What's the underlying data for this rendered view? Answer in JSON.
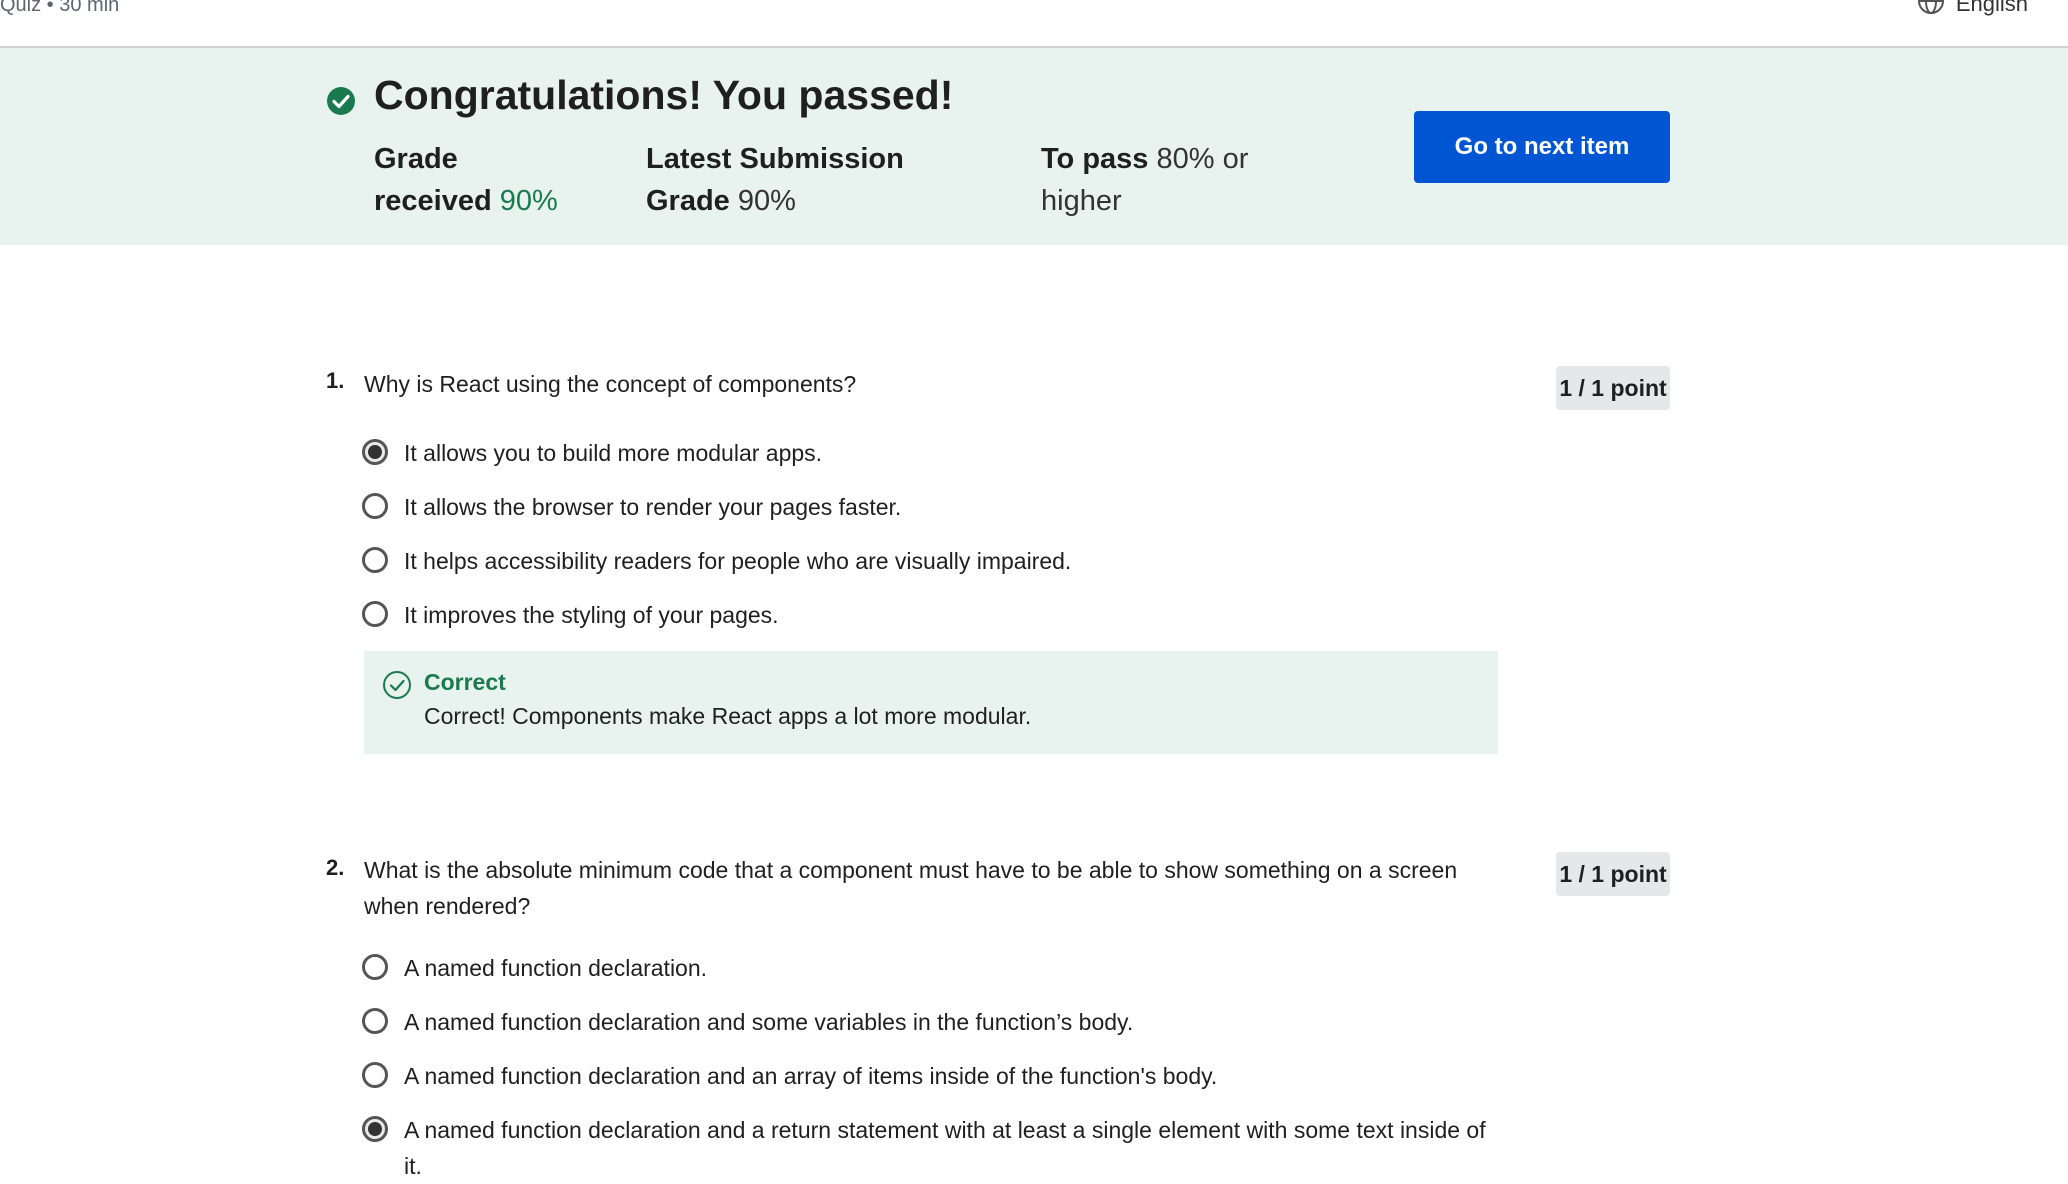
{
  "header": {
    "quiz_meta": "Quiz • 30 min",
    "language": "English"
  },
  "banner": {
    "title": "Congratulations! You passed!",
    "grade_label_1": "Grade",
    "grade_label_2": "received",
    "grade_value": "90%",
    "latest_label_1": "Latest Submission",
    "latest_label_2": "Grade",
    "latest_value": "90%",
    "pass_label": "To pass",
    "pass_value_1": "80% or",
    "pass_value_2": "higher",
    "next_button": "Go to next item"
  },
  "questions": [
    {
      "number": "1.",
      "text": "Why is React using the concept of components?",
      "points": "1 / 1 point",
      "selected_index": 0,
      "options": [
        "It allows you to build more modular apps.",
        "It allows the browser to render your pages faster.",
        "It helps accessibility readers for people who are visually impaired.",
        "It improves the styling of your pages."
      ],
      "feedback": {
        "title": "Correct",
        "text": "Correct! Components make React apps a lot more modular."
      }
    },
    {
      "number": "2.",
      "text": "What is the absolute minimum code that a component must have to be able to show something on a screen when rendered?",
      "points": "1 / 1 point",
      "selected_index": 3,
      "options": [
        "A named function declaration.",
        "A named function declaration and some variables in the function’s body.",
        "A named function declaration and an array of items inside of the function's body.",
        "A named function declaration and a return statement with at least a single element with some text inside of it."
      ]
    }
  ],
  "colors": {
    "banner_bg": "#e8f2ee",
    "success_green": "#1a7a4e",
    "primary_blue": "#0056d2"
  }
}
